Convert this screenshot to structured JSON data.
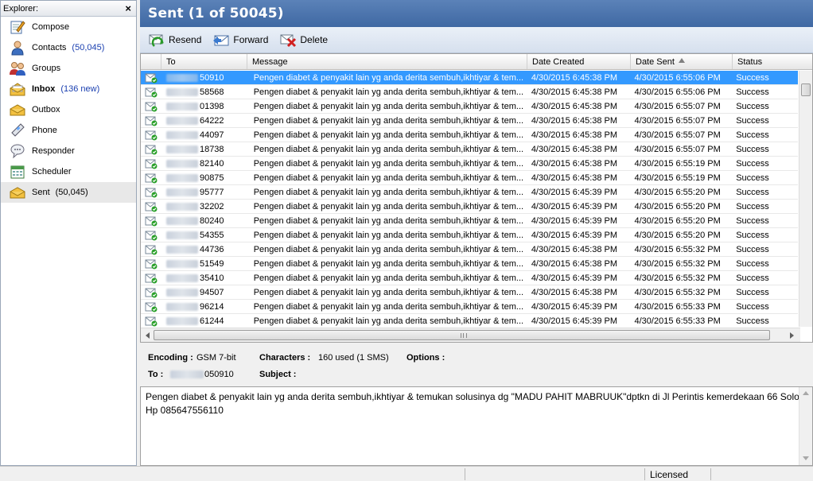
{
  "sidebar": {
    "title": "Explorer:",
    "close": "×",
    "items": [
      {
        "label": "Compose",
        "icon": "compose-icon"
      },
      {
        "label": "Contacts",
        "count": "(50,045)",
        "icon": "contacts-icon"
      },
      {
        "label": "Groups",
        "icon": "groups-icon"
      },
      {
        "label": "Inbox",
        "count": "(136 new)",
        "icon": "inbox-icon",
        "bold": true
      },
      {
        "label": "Outbox",
        "icon": "outbox-icon"
      },
      {
        "label": "Phone",
        "icon": "phone-icon"
      },
      {
        "label": "Responder",
        "icon": "responder-icon"
      },
      {
        "label": "Scheduler",
        "icon": "scheduler-icon"
      },
      {
        "label": "Sent",
        "count": "(50,045)",
        "icon": "sent-icon",
        "selected": true
      }
    ]
  },
  "main": {
    "title": "Sent (1 of 50045)",
    "toolbar": {
      "resend": "Resend",
      "forward": "Forward",
      "delete": "Delete"
    }
  },
  "grid": {
    "columns": {
      "to": "To",
      "message": "Message",
      "date_created": "Date Created",
      "date_sent": "Date Sent",
      "status": "Status"
    },
    "rows": [
      {
        "to": "50910",
        "message": "Pengen diabet & penyakit lain yg anda derita sembuh,ikhtiyar & tem...",
        "date_created": "4/30/2015 6:45:38 PM",
        "date_sent": "4/30/2015 6:55:06 PM",
        "status": "Success",
        "selected": true
      },
      {
        "to": "58568",
        "message": "Pengen diabet & penyakit lain yg anda derita sembuh,ikhtiyar & tem...",
        "date_created": "4/30/2015 6:45:38 PM",
        "date_sent": "4/30/2015 6:55:06 PM",
        "status": "Success"
      },
      {
        "to": "01398",
        "message": "Pengen diabet & penyakit lain yg anda derita sembuh,ikhtiyar & tem...",
        "date_created": "4/30/2015 6:45:38 PM",
        "date_sent": "4/30/2015 6:55:07 PM",
        "status": "Success"
      },
      {
        "to": "64222",
        "message": "Pengen diabet & penyakit lain yg anda derita sembuh,ikhtiyar & tem...",
        "date_created": "4/30/2015 6:45:38 PM",
        "date_sent": "4/30/2015 6:55:07 PM",
        "status": "Success"
      },
      {
        "to": "44097",
        "message": "Pengen diabet & penyakit lain yg anda derita sembuh,ikhtiyar & tem...",
        "date_created": "4/30/2015 6:45:38 PM",
        "date_sent": "4/30/2015 6:55:07 PM",
        "status": "Success"
      },
      {
        "to": "18738",
        "message": "Pengen diabet & penyakit lain yg anda derita sembuh,ikhtiyar & tem...",
        "date_created": "4/30/2015 6:45:38 PM",
        "date_sent": "4/30/2015 6:55:07 PM",
        "status": "Success"
      },
      {
        "to": "82140",
        "message": "Pengen diabet & penyakit lain yg anda derita sembuh,ikhtiyar & tem...",
        "date_created": "4/30/2015 6:45:38 PM",
        "date_sent": "4/30/2015 6:55:19 PM",
        "status": "Success"
      },
      {
        "to": "90875",
        "message": "Pengen diabet & penyakit lain yg anda derita sembuh,ikhtiyar & tem...",
        "date_created": "4/30/2015 6:45:38 PM",
        "date_sent": "4/30/2015 6:55:19 PM",
        "status": "Success"
      },
      {
        "to": "95777",
        "message": "Pengen diabet & penyakit lain yg anda derita sembuh,ikhtiyar & tem...",
        "date_created": "4/30/2015 6:45:39 PM",
        "date_sent": "4/30/2015 6:55:20 PM",
        "status": "Success"
      },
      {
        "to": "32202",
        "message": "Pengen diabet & penyakit lain yg anda derita sembuh,ikhtiyar & tem...",
        "date_created": "4/30/2015 6:45:39 PM",
        "date_sent": "4/30/2015 6:55:20 PM",
        "status": "Success"
      },
      {
        "to": "80240",
        "message": "Pengen diabet & penyakit lain yg anda derita sembuh,ikhtiyar & tem...",
        "date_created": "4/30/2015 6:45:39 PM",
        "date_sent": "4/30/2015 6:55:20 PM",
        "status": "Success"
      },
      {
        "to": "54355",
        "message": "Pengen diabet & penyakit lain yg anda derita sembuh,ikhtiyar & tem...",
        "date_created": "4/30/2015 6:45:39 PM",
        "date_sent": "4/30/2015 6:55:20 PM",
        "status": "Success"
      },
      {
        "to": "44736",
        "message": "Pengen diabet & penyakit lain yg anda derita sembuh,ikhtiyar & tem...",
        "date_created": "4/30/2015 6:45:38 PM",
        "date_sent": "4/30/2015 6:55:32 PM",
        "status": "Success"
      },
      {
        "to": "51549",
        "message": "Pengen diabet & penyakit lain yg anda derita sembuh,ikhtiyar & tem...",
        "date_created": "4/30/2015 6:45:38 PM",
        "date_sent": "4/30/2015 6:55:32 PM",
        "status": "Success"
      },
      {
        "to": "35410",
        "message": "Pengen diabet & penyakit lain yg anda derita sembuh,ikhtiyar & tem...",
        "date_created": "4/30/2015 6:45:39 PM",
        "date_sent": "4/30/2015 6:55:32 PM",
        "status": "Success"
      },
      {
        "to": "94507",
        "message": "Pengen diabet & penyakit lain yg anda derita sembuh,ikhtiyar & tem...",
        "date_created": "4/30/2015 6:45:38 PM",
        "date_sent": "4/30/2015 6:55:32 PM",
        "status": "Success"
      },
      {
        "to": "96214",
        "message": "Pengen diabet & penyakit lain yg anda derita sembuh,ikhtiyar & tem...",
        "date_created": "4/30/2015 6:45:39 PM",
        "date_sent": "4/30/2015 6:55:33 PM",
        "status": "Success"
      },
      {
        "to": "61244",
        "message": "Pengen diabet & penyakit lain yg anda derita sembuh,ikhtiyar & tem...",
        "date_created": "4/30/2015 6:45:39 PM",
        "date_sent": "4/30/2015 6:55:33 PM",
        "status": "Success"
      }
    ]
  },
  "details": {
    "encoding_label": "Encoding :",
    "encoding_value": "GSM 7-bit",
    "characters_label": "Characters :",
    "characters_value": "160 used (1 SMS)",
    "options_label": "Options :",
    "to_label": "To :",
    "to_value": "050910",
    "subject_label": "Subject :",
    "message": "Pengen diabet & penyakit lain yg anda derita sembuh,ikhtiyar & temukan solusinya dg \"MADU PAHIT MABRUUK\"dptkn di Jl Perintis kemerdekaan 66 Solo Hp 085647556110"
  },
  "statusbar": {
    "text": "Licensed"
  },
  "colors": {
    "title_bar": "#4a74ad",
    "selection": "#3399ff",
    "count_link": "#1a3fb0"
  }
}
